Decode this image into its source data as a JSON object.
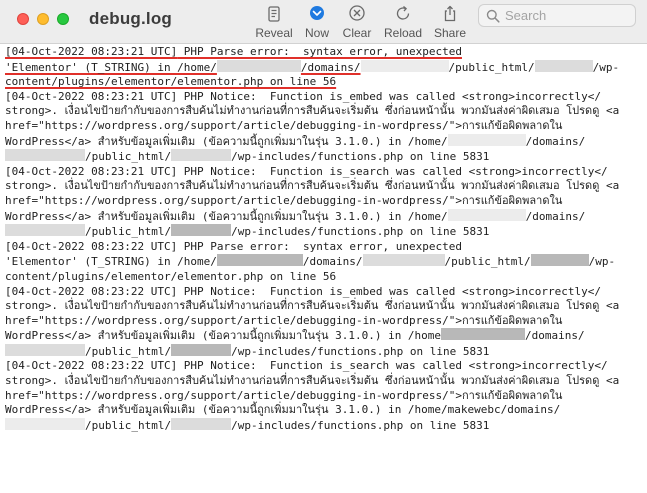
{
  "window": {
    "title": "debug.log"
  },
  "toolbar": {
    "reveal": "Reveal",
    "now": "Now",
    "clear": "Clear",
    "reload": "Reload",
    "share": "Share"
  },
  "search": {
    "placeholder": "Search",
    "value": ""
  },
  "log": {
    "l1a": "[04-Oct-2022 08:23:21 UTC]",
    "l1b": " PHP Parse error:  syntax error, unexpected",
    "l2a": "'Elementor' (T_STRING) in /home/",
    "l2b": "/domains/",
    "l2c": "/public_html/",
    "l2d": "/wp-",
    "l3": "content/plugins/elementor/elementor.php on line 56",
    "l4": "[04-Oct-2022 08:23:21 UTC] PHP Notice:  Function is_embed was called <strong>incorrectly</",
    "l5": "strong>. เงื่อนไขป้ายกำกับของการสืบค้นไม่ทำงานก่อนที่การสืบค้นจะเริ่มต้น ซึ่งก่อนหน้านั้น พวกมันส่งค่าผิดเสมอ โปรดดู <a",
    "l6": "href=\"https://wordpress.org/support/article/debugging-in-wordpress/\">การแก้ข้อผิดพลาดใน",
    "l7a": "WordPress</a> สำหรับข้อมูลเพิ่มเติม (ข้อความนี้ถูกเพิ่มมาในรุ่น 3.1.0.) in /home/",
    "l7b": "/domains/",
    "l8a": "/public_html/",
    "l8b": "/wp-includes/functions.php on line 5831",
    "l9": "[04-Oct-2022 08:23:21 UTC] PHP Notice:  Function is_search was called <strong>incorrectly</",
    "l10": "strong>. เงื่อนไขป้ายกำกับของการสืบค้นไม่ทำงานก่อนที่การสืบค้นจะเริ่มต้น ซึ่งก่อนหน้านั้น พวกมันส่งค่าผิดเสมอ โปรดดู <a",
    "l11": "href=\"https://wordpress.org/support/article/debugging-in-wordpress/\">การแก้ข้อผิดพลาดใน",
    "l12a": "WordPress</a> สำหรับข้อมูลเพิ่มเติม (ข้อความนี้ถูกเพิ่มมาในรุ่น 3.1.0.) in /home/",
    "l12b": "/domains/",
    "l13a": "/public_html/",
    "l13b": "/wp-includes/functions.php on line 5831",
    "l14": "[04-Oct-2022 08:23:22 UTC] PHP Parse error:  syntax error, unexpected",
    "l15a": "'Elementor' (T_STRING) in /home/",
    "l15b": "/domains/",
    "l15c": "/public_html/",
    "l15d": "/wp-",
    "l16": "content/plugins/elementor/elementor.php on line 56",
    "l17": "[04-Oct-2022 08:23:22 UTC] PHP Notice:  Function is_embed was called <strong>incorrectly</",
    "l18": "strong>. เงื่อนไขป้ายกำกับของการสืบค้นไม่ทำงานก่อนที่การสืบค้นจะเริ่มต้น ซึ่งก่อนหน้านั้น พวกมันส่งค่าผิดเสมอ โปรดดู <a",
    "l19": "href=\"https://wordpress.org/support/article/debugging-in-wordpress/\">การแก้ข้อผิดพลาดใน",
    "l20a": "WordPress</a> สำหรับข้อมูลเพิ่มเติม (ข้อความนี้ถูกเพิ่มมาในรุ่น 3.1.0.) in /home",
    "l20b": "/domains/",
    "l21a": "/public_html/",
    "l21b": "/wp-includes/functions.php on line 5831",
    "l22": "[04-Oct-2022 08:23:22 UTC] PHP Notice:  Function is_search was called <strong>incorrectly</",
    "l23": "strong>. เงื่อนไขป้ายกำกับของการสืบค้นไม่ทำงานก่อนที่การสืบค้นจะเริ่มต้น ซึ่งก่อนหน้านั้น พวกมันส่งค่าผิดเสมอ โปรดดู <a",
    "l24": "href=\"https://wordpress.org/support/article/debugging-in-wordpress/\">การแก้ข้อผิดพลาดใน",
    "l25": "WordPress</a> สำหรับข้อมูลเพิ่มเติม (ข้อความนี้ถูกเพิ่มมาในรุ่น 3.1.0.) in /home/makewebc/domains/",
    "l26a": "/public_html/",
    "l26b": "/wp-includes/functions.php on line 5831"
  },
  "colors": {
    "annotation": "#e0302a",
    "titlebar": "#ededed",
    "accent": "#1f7ae0"
  }
}
